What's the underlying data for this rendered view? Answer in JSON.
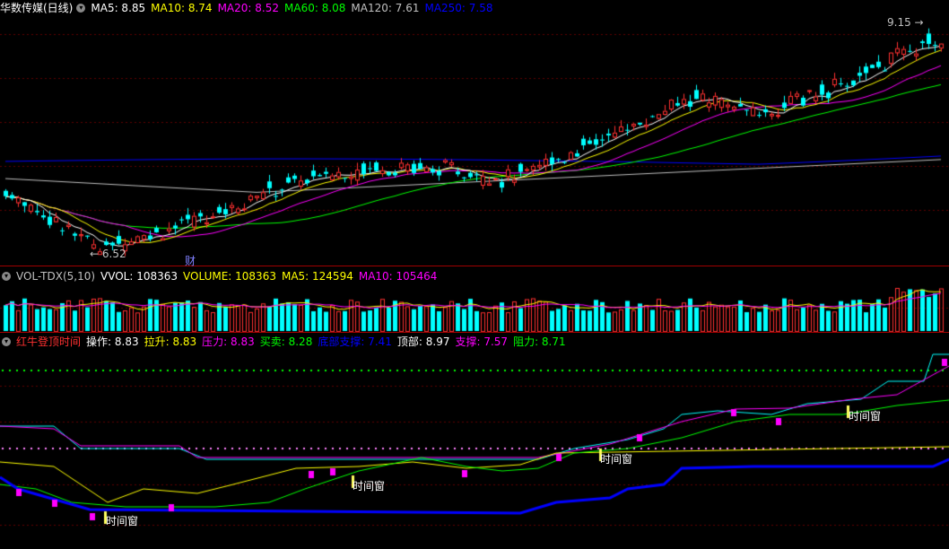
{
  "main": {
    "title": "华数传媒(日线)",
    "ma": [
      {
        "label": "MA5: 8.85",
        "color": "#ffffff"
      },
      {
        "label": "MA10: 8.74",
        "color": "#ffff00"
      },
      {
        "label": "MA20: 8.52",
        "color": "#ff00ff"
      },
      {
        "label": "MA60: 8.08",
        "color": "#00ff00"
      },
      {
        "label": "MA120: 7.61",
        "color": "#c0c0c0"
      },
      {
        "label": "MA250: 7.58",
        "color": "#0000ff"
      }
    ],
    "high_label": "9.15",
    "low_label": "6.52",
    "cai_label": "财"
  },
  "volume": {
    "title": "VOL-TDX(5,10)",
    "items": [
      {
        "label": "VVOL: 108363",
        "color": "#ffffff"
      },
      {
        "label": "VOLUME: 108363",
        "color": "#ffff00"
      },
      {
        "label": "MA5: 124594",
        "color": "#ffff00"
      },
      {
        "label": "MA10: 105464",
        "color": "#ff00ff"
      }
    ]
  },
  "indicator": {
    "title": "红牛登顶时间",
    "items": [
      {
        "label": "操作: 8.83",
        "color": "#ffffff"
      },
      {
        "label": "拉升: 8.83",
        "color": "#ffff00"
      },
      {
        "label": "压力: 8.83",
        "color": "#ff00ff"
      },
      {
        "label": "买卖: 8.28",
        "color": "#00ff00"
      },
      {
        "label": "底部支撑: 7.41",
        "color": "#0000ff"
      },
      {
        "label": "顶部: 8.97",
        "color": "#ffffff"
      },
      {
        "label": "支撑: 7.57",
        "color": "#ff00ff"
      },
      {
        "label": "阻力: 8.71",
        "color": "#00ff00"
      }
    ],
    "window_labels": [
      "时间窗",
      "时间窗",
      "时间窗",
      "时间窗"
    ]
  },
  "colors": {
    "up": "#ff3030",
    "down": "#00ffff",
    "separator": "#a00000",
    "grid": "#600000"
  }
}
